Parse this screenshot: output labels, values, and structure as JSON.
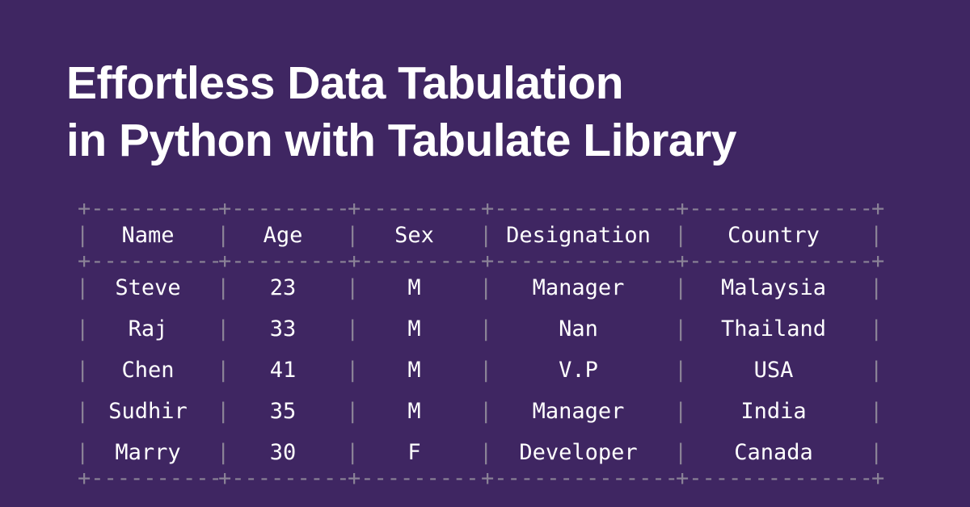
{
  "banner": {
    "background_color": "#3f2662",
    "title_color": "#ffffff",
    "table_text_color": "#ffffff",
    "table_border_color": "#8a8296",
    "title_lines": [
      "Effortless Data Tabulation",
      "in Python with Tabulate Library"
    ]
  },
  "table": {
    "columns": [
      "Name",
      "Age",
      "Sex",
      "Designation",
      "Country"
    ],
    "rows": [
      [
        "Steve",
        "23",
        "M",
        "Manager",
        "Malaysia"
      ],
      [
        "Raj",
        "33",
        "M",
        "Nan",
        "Thailand"
      ],
      [
        "Chen",
        "41",
        "M",
        "V.P",
        "USA"
      ],
      [
        "Sudhir",
        "35",
        "M",
        "Manager",
        "India"
      ],
      [
        "Marry",
        "30",
        "F",
        "Developer",
        "Canada"
      ]
    ],
    "border_glyphs": {
      "junction": "+",
      "horizontal": "-",
      "vertical": "|"
    },
    "rules": {
      "top": "+-----------+--------+-------+---------------+--------------+",
      "header_separator": "+-----------+--------+-------+---------------+--------------+",
      "bottom": "+-----------+--------+-------+---------------+--------------+"
    }
  }
}
